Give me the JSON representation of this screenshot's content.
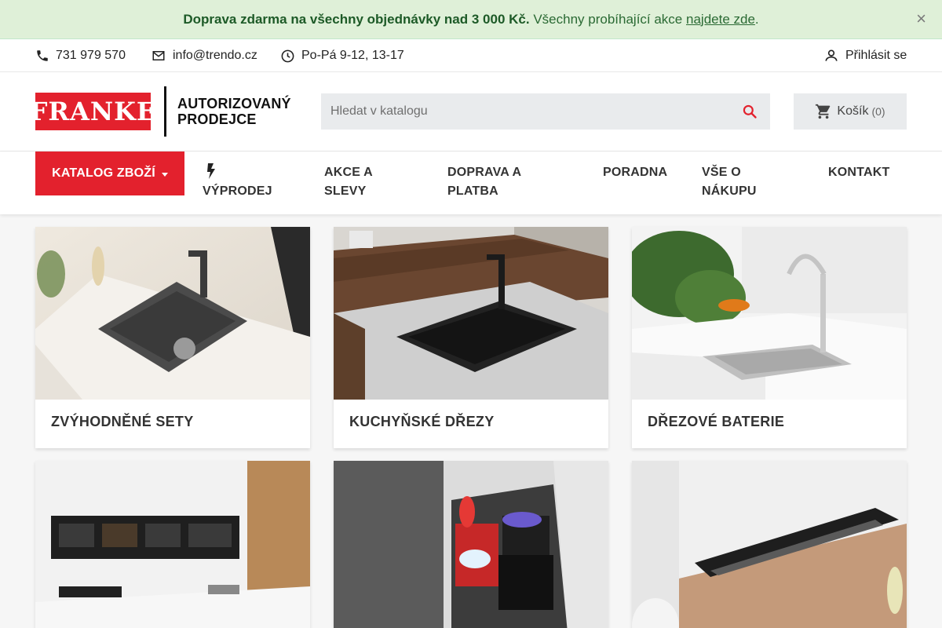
{
  "promo": {
    "bold_text": "Doprava zdarma na všechny objednávky nad 3 000 Kč.",
    "text": "Všechny probíhající akce",
    "link_text": "najdete zde",
    "suffix": ".",
    "close_label": "×"
  },
  "contact": {
    "phone": "731 979 570",
    "email": "info@trendo.cz",
    "hours": "Po-Pá 9-12, 13-17",
    "login_label": "Přihlásit se"
  },
  "header": {
    "logo_text": "FRANKE",
    "logo_subtitle_line1": "AUTORIZOVANÝ",
    "logo_subtitle_line2": "PRODEJCE",
    "search_placeholder": "Hledat v katalogu",
    "cart_label": "Košík",
    "cart_count": "(0)"
  },
  "nav": {
    "catalog_label": "KATALOG ZBOŽÍ",
    "items": [
      {
        "line1": "",
        "line2": "VÝPRODEJ",
        "icon": "flash-icon"
      },
      {
        "line1": "AKCE A",
        "line2": "SLEVY"
      },
      {
        "line1": "DOPRAVA A",
        "line2": "PLATBA"
      },
      {
        "line1": "PORADNA",
        "line2": ""
      },
      {
        "line1": "VŠE O",
        "line2": "NÁKUPU"
      },
      {
        "line1": "KONTAKT",
        "line2": ""
      }
    ]
  },
  "categories": [
    {
      "title": "ZVÝHODNĚNÉ SETY"
    },
    {
      "title": "KUCHYŇSKÉ DŘEZY"
    },
    {
      "title": "DŘEZOVÉ BATERIE"
    },
    {
      "title": ""
    },
    {
      "title": ""
    },
    {
      "title": ""
    }
  ],
  "colors": {
    "brand_red": "#e3212d",
    "promo_bg": "#dff0d8",
    "promo_text": "#2b6a34"
  }
}
